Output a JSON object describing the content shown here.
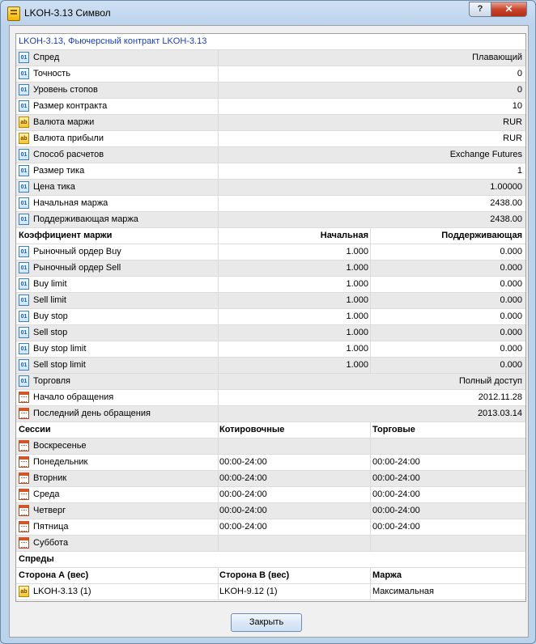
{
  "window": {
    "title": "LKOH-3.13 Символ",
    "help_label": "?",
    "close_label": "✕"
  },
  "header": "LKOH-3.13, Фьючерсный контракт LKOH-3.13",
  "properties": [
    {
      "icon": "numeric-icon",
      "label": "Спред",
      "value": "Плавающий"
    },
    {
      "icon": "numeric-icon",
      "label": "Точность",
      "value": "0"
    },
    {
      "icon": "numeric-icon",
      "label": "Уровень стопов",
      "value": "0"
    },
    {
      "icon": "numeric-icon",
      "label": "Размер контракта",
      "value": "10"
    },
    {
      "icon": "string-icon",
      "label": "Валюта маржи",
      "value": "RUR"
    },
    {
      "icon": "string-icon",
      "label": "Валюта прибыли",
      "value": "RUR"
    },
    {
      "icon": "numeric-icon",
      "label": "Способ расчетов",
      "value": "Exchange Futures"
    },
    {
      "icon": "numeric-icon",
      "label": "Размер тика",
      "value": "1"
    },
    {
      "icon": "numeric-icon",
      "label": "Цена тика",
      "value": "1.00000"
    },
    {
      "icon": "numeric-icon",
      "label": "Начальная маржа",
      "value": "2438.00"
    },
    {
      "icon": "numeric-icon",
      "label": "Поддерживающая маржа",
      "value": "2438.00"
    }
  ],
  "margin": {
    "headers": [
      "Коэффициент маржи",
      "Начальная",
      "Поддерживающая"
    ],
    "rows": [
      {
        "label": "Рыночный ордер Buy",
        "initial": "1.000",
        "maintenance": "0.000"
      },
      {
        "label": "Рыночный ордер Sell",
        "initial": "1.000",
        "maintenance": "0.000"
      },
      {
        "label": "Buy limit",
        "initial": "1.000",
        "maintenance": "0.000"
      },
      {
        "label": "Sell limit",
        "initial": "1.000",
        "maintenance": "0.000"
      },
      {
        "label": "Buy stop",
        "initial": "1.000",
        "maintenance": "0.000"
      },
      {
        "label": "Sell stop",
        "initial": "1.000",
        "maintenance": "0.000"
      },
      {
        "label": "Buy stop limit",
        "initial": "1.000",
        "maintenance": "0.000"
      },
      {
        "label": "Sell stop limit",
        "initial": "1.000",
        "maintenance": "0.000"
      }
    ]
  },
  "trading": [
    {
      "icon": "numeric-icon",
      "label": "Торговля",
      "value": "Полный доступ"
    },
    {
      "icon": "calendar-icon",
      "label": "Начало обращения",
      "value": "2012.11.28"
    },
    {
      "icon": "calendar-icon",
      "label": "Последний день обращения",
      "value": "2013.03.14"
    }
  ],
  "sessions": {
    "headers": [
      "Сессии",
      "Котировочные",
      "Торговые"
    ],
    "rows": [
      {
        "day": "Воскресенье",
        "quotes": "",
        "trades": ""
      },
      {
        "day": "Понедельник",
        "quotes": "00:00-24:00",
        "trades": "00:00-24:00"
      },
      {
        "day": "Вторник",
        "quotes": "00:00-24:00",
        "trades": "00:00-24:00"
      },
      {
        "day": "Среда",
        "quotes": "00:00-24:00",
        "trades": "00:00-24:00"
      },
      {
        "day": "Четверг",
        "quotes": "00:00-24:00",
        "trades": "00:00-24:00"
      },
      {
        "day": "Пятница",
        "quotes": "00:00-24:00",
        "trades": "00:00-24:00"
      },
      {
        "day": "Суббота",
        "quotes": "",
        "trades": ""
      }
    ]
  },
  "spreads": {
    "title": "Спреды",
    "headers": [
      "Сторона А (вес)",
      "Сторона B (вес)",
      "Маржа"
    ],
    "rows": [
      {
        "side_a": "LKOH-3.13 (1)",
        "side_b": "LKOH-9.12 (1)",
        "margin": "Максимальная"
      }
    ]
  },
  "footer": {
    "close_button": "Закрыть"
  }
}
